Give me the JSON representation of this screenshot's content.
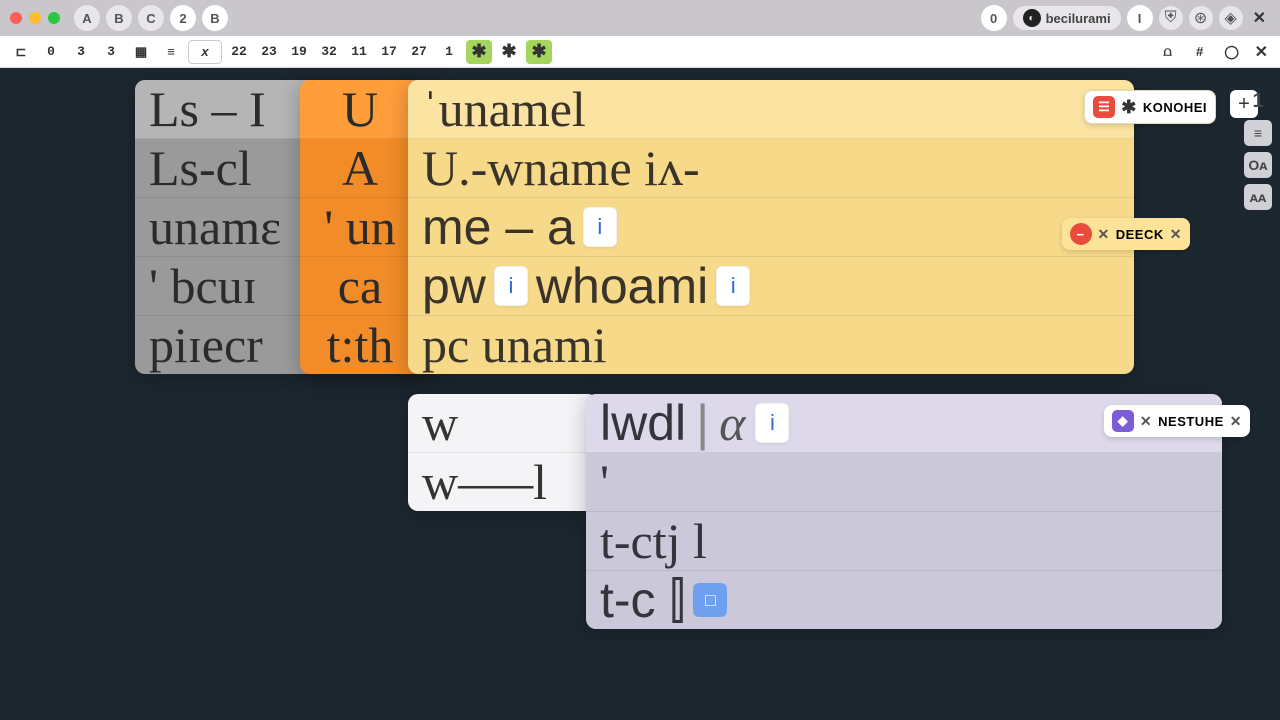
{
  "titlebar": {
    "tabs": [
      "A",
      "B",
      "C",
      "2",
      "B"
    ],
    "right_zero": "0",
    "account": "becilurami",
    "right_i": "I"
  },
  "toolbar": {
    "items": [
      "⊏",
      "0",
      "3",
      "3",
      "▦",
      "≡"
    ],
    "dropdown": "x",
    "nums": [
      "22",
      "23",
      "19",
      "32",
      "11",
      "17",
      "27",
      "1"
    ],
    "stars": [
      "✱",
      "✱",
      "✱"
    ]
  },
  "panels": {
    "gray": [
      "Ls – I",
      "Ls-cl",
      "unamɛ",
      "' bcuɪ",
      "piɪecr"
    ],
    "orange": [
      "U",
      "A",
      "' un",
      "ca",
      "t:th"
    ],
    "yellow": {
      "r1": "ˈunamel",
      "r2": "U.-wname iᴧ-",
      "r3_a": "me – a",
      "r4_a": "pw",
      "r4_b": "whoami",
      "r5": "pc unami"
    },
    "white": [
      "w",
      "w—–l"
    ],
    "lavender": {
      "head": "lwdl",
      "r2": "'",
      "r3": "t-ctj l",
      "r4": "t-c ⫿"
    }
  },
  "tags": {
    "konohei": "KONOHEI",
    "deeck": "DEECK",
    "nesture": "NESTUНE"
  },
  "rightdock": [
    "1",
    "≡",
    "Oᴀ",
    "ᴀᴀ"
  ]
}
